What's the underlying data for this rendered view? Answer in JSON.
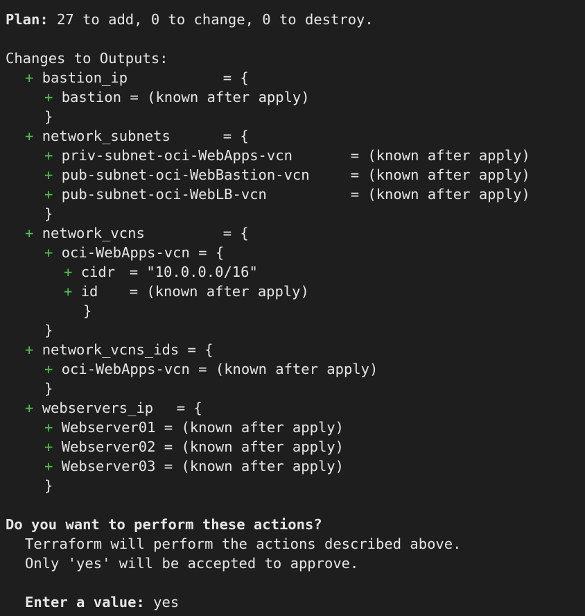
{
  "plan": {
    "label": "Plan:",
    "summary": " 27 to add, 0 to change, 0 to destroy."
  },
  "outputs_header": "Changes to Outputs:",
  "plus": "+",
  "open_brace": "= {",
  "close_brace": "}",
  "outputs": {
    "bastion_ip": {
      "name": "bastion_ip",
      "items": [
        {
          "key": "bastion",
          "value": "= (known after apply)"
        }
      ]
    },
    "network_subnets": {
      "name": "network_subnets",
      "items": [
        {
          "key": "priv-subnet-oci-WebApps-vcn",
          "value": "= (known after apply)"
        },
        {
          "key": "pub-subnet-oci-WebBastion-vcn",
          "value": "= (known after apply)"
        },
        {
          "key": "pub-subnet-oci-WebLB-vcn",
          "value": "= (known after apply)"
        }
      ]
    },
    "network_vcns": {
      "name": "network_vcns",
      "vcn_key": "oci-WebApps-vcn",
      "vcn_open": "= {",
      "items": [
        {
          "key": "cidr",
          "value": "= \"10.0.0.0/16\""
        },
        {
          "key": "id",
          "value": "= (known after apply)"
        }
      ]
    },
    "network_vcns_ids": {
      "name": "network_vcns_ids",
      "items": [
        {
          "key": "oci-WebApps-vcn",
          "value": "= (known after apply)"
        }
      ]
    },
    "webservers_ip": {
      "name": "webservers_ip",
      "items": [
        {
          "key": "Webserver01",
          "value": "= (known after apply)"
        },
        {
          "key": "Webserver02",
          "value": "= (known after apply)"
        },
        {
          "key": "Webserver03",
          "value": "= (known after apply)"
        }
      ]
    }
  },
  "prompt": {
    "question": "Do you want to perform these actions?",
    "line1": "Terraform will perform the actions described above.",
    "line2": "Only 'yes' will be accepted to approve.",
    "input_label": "Enter a value:",
    "input_value": " yes"
  },
  "colors": {
    "background": "#1e1e1e",
    "text": "#e6e6e6",
    "plus": "#4ec24e"
  }
}
